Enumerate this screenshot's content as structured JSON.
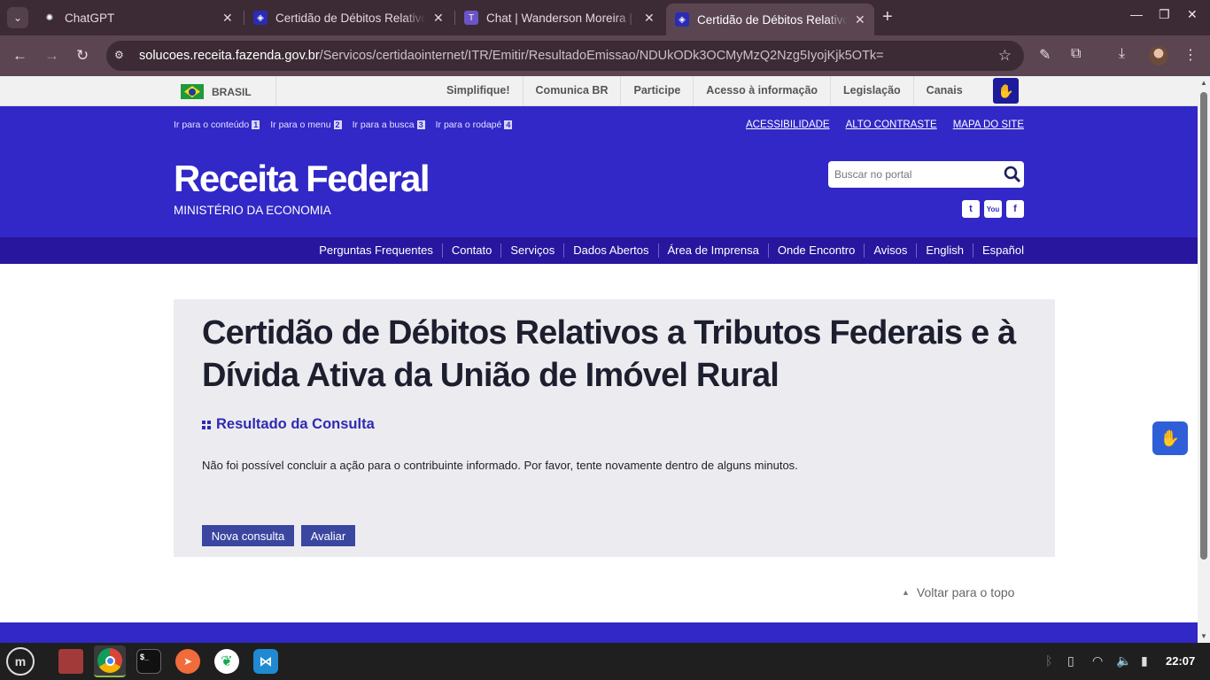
{
  "browser": {
    "tabs": [
      {
        "title": "ChatGPT",
        "active": false
      },
      {
        "title": "Certidão de Débitos Relativos",
        "active": false
      },
      {
        "title": "Chat | Wanderson Moreira | M",
        "active": false
      },
      {
        "title": "Certidão de Débitos Relativos",
        "active": true
      }
    ],
    "url_host": "solucoes.receita.fazenda.gov.br",
    "url_path": "/Servicos/certidaointernet/ITR/Emitir/ResultadoEmissao/NDUkODk3OCMyMzQ2Nzg5IyojKjk5OTk="
  },
  "govbar": {
    "brasil": "BRASIL",
    "links": [
      "Simplifique!",
      "Comunica BR",
      "Participe",
      "Acesso à informação",
      "Legislação",
      "Canais"
    ]
  },
  "header": {
    "skiplinks": [
      {
        "label": "Ir para o conteúdo",
        "num": "1"
      },
      {
        "label": "Ir para o menu",
        "num": "2"
      },
      {
        "label": "Ir para a busca",
        "num": "3"
      },
      {
        "label": "Ir para o rodapé",
        "num": "4"
      }
    ],
    "access_links": [
      "ACESSIBILIDADE",
      "ALTO CONTRASTE",
      "MAPA DO SITE"
    ],
    "title": "Receita Federal",
    "subtitle": "MINISTÉRIO DA ECONOMIA",
    "search_placeholder": "Buscar no portal",
    "social": [
      "twitter-icon",
      "youtube-icon",
      "facebook-icon"
    ]
  },
  "nav": {
    "links": [
      "Perguntas Frequentes",
      "Contato",
      "Serviços",
      "Dados Abertos",
      "Área de Imprensa",
      "Onde Encontro",
      "Avisos",
      "English",
      "Español"
    ]
  },
  "main": {
    "title": "Certidão de Débitos Relativos a Tributos Federais e à Dívida Ativa da União de Imóvel Rural",
    "result_heading": "Resultado da Consulta",
    "result_message": "Não foi possível concluir a ação para o contribuinte informado. Por favor, tente novamente dentro de alguns minutos.",
    "buttons": {
      "new_query": "Nova consulta",
      "evaluate": "Avaliar"
    },
    "back_to_top": "Voltar para o topo"
  },
  "taskbar": {
    "clock": "22:07"
  },
  "colors": {
    "header_blue": "#3128c7",
    "nav_blue": "#28169e",
    "button_blue": "#3b46a0",
    "browser_frame": "#3c2b34"
  }
}
